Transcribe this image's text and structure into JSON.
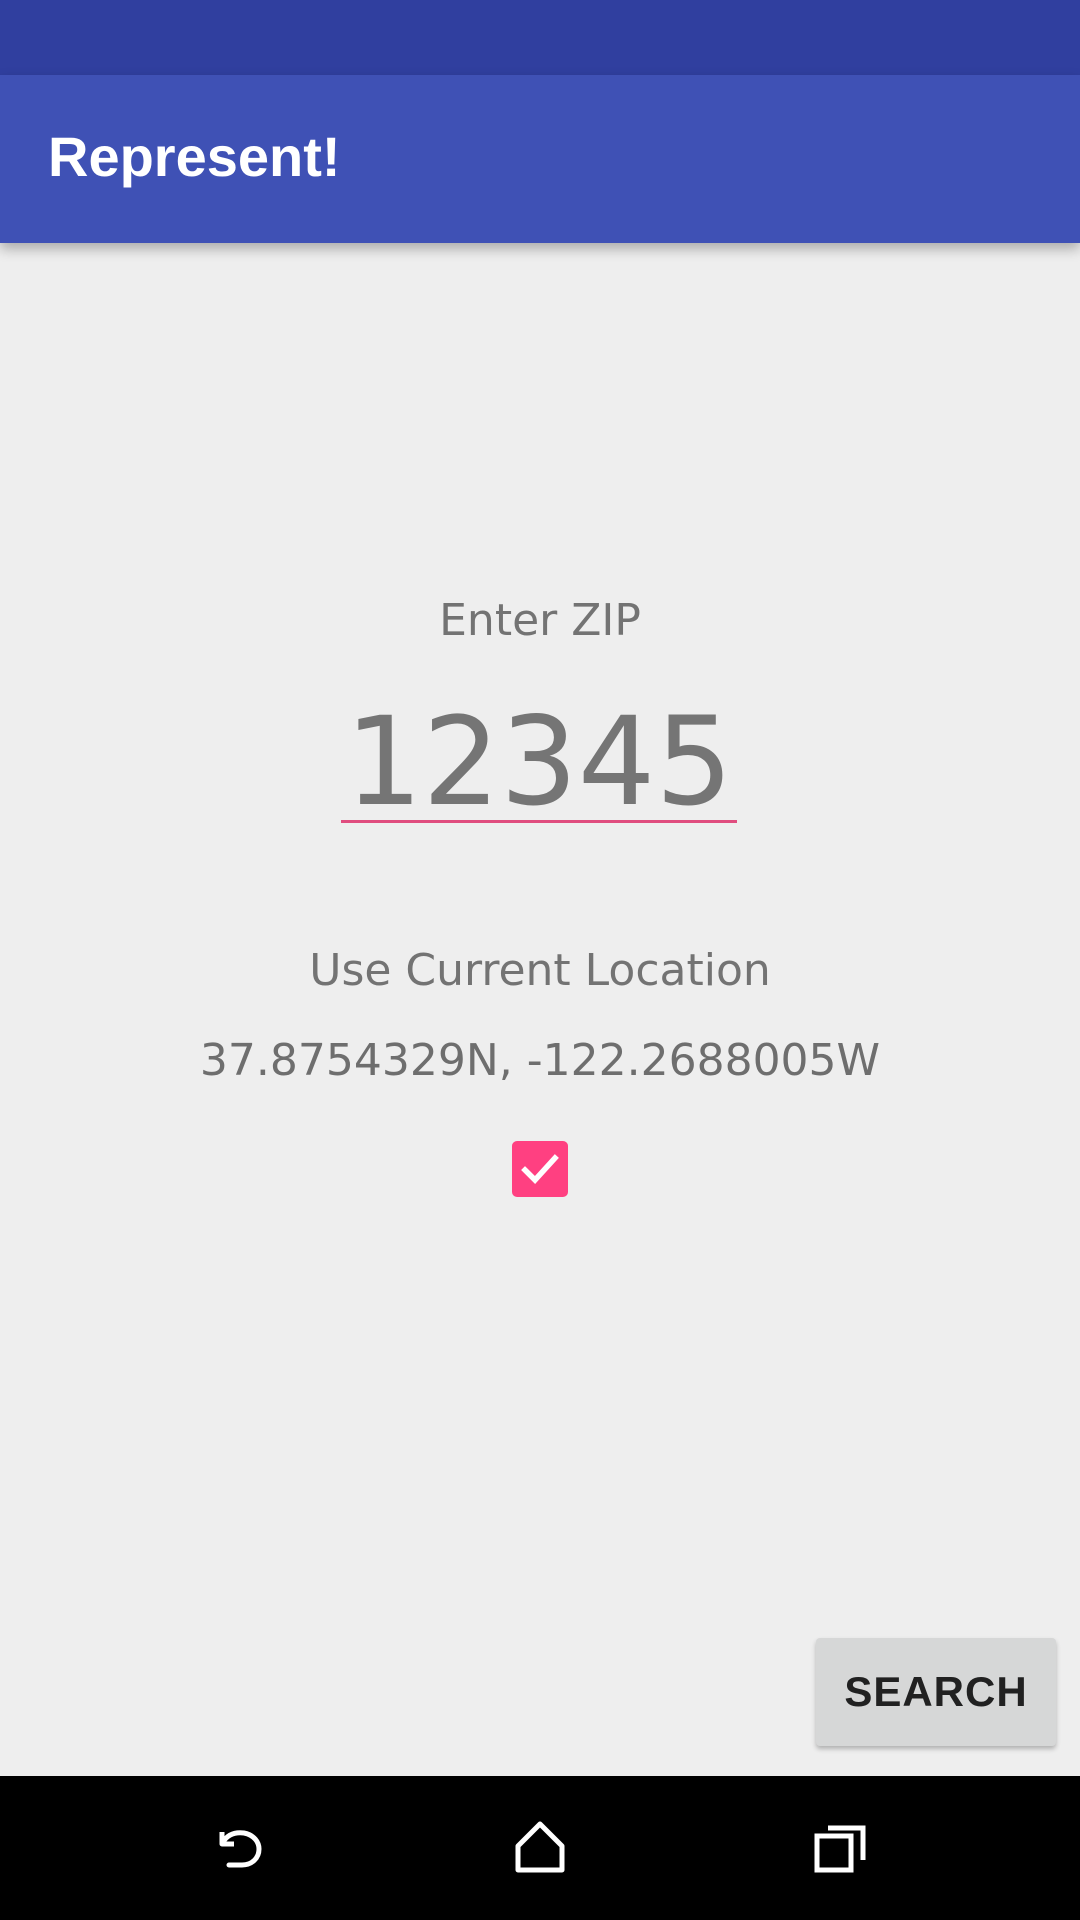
{
  "app_bar": {
    "title": "Represent!"
  },
  "form": {
    "zip_label": "Enter ZIP",
    "zip_value": "12345",
    "location_label": "Use Current Location",
    "coordinates": "37.8754329N, -122.2688005W",
    "use_location_checked": true
  },
  "actions": {
    "search_label": "SEARCH"
  },
  "nav": {
    "back_icon": "back-icon",
    "home_icon": "home-icon",
    "recents_icon": "recents-icon"
  },
  "colors": {
    "status_bar": "#303f9f",
    "app_bar": "#3f51b5",
    "accent": "#ff4081",
    "background": "#eeeeee"
  }
}
